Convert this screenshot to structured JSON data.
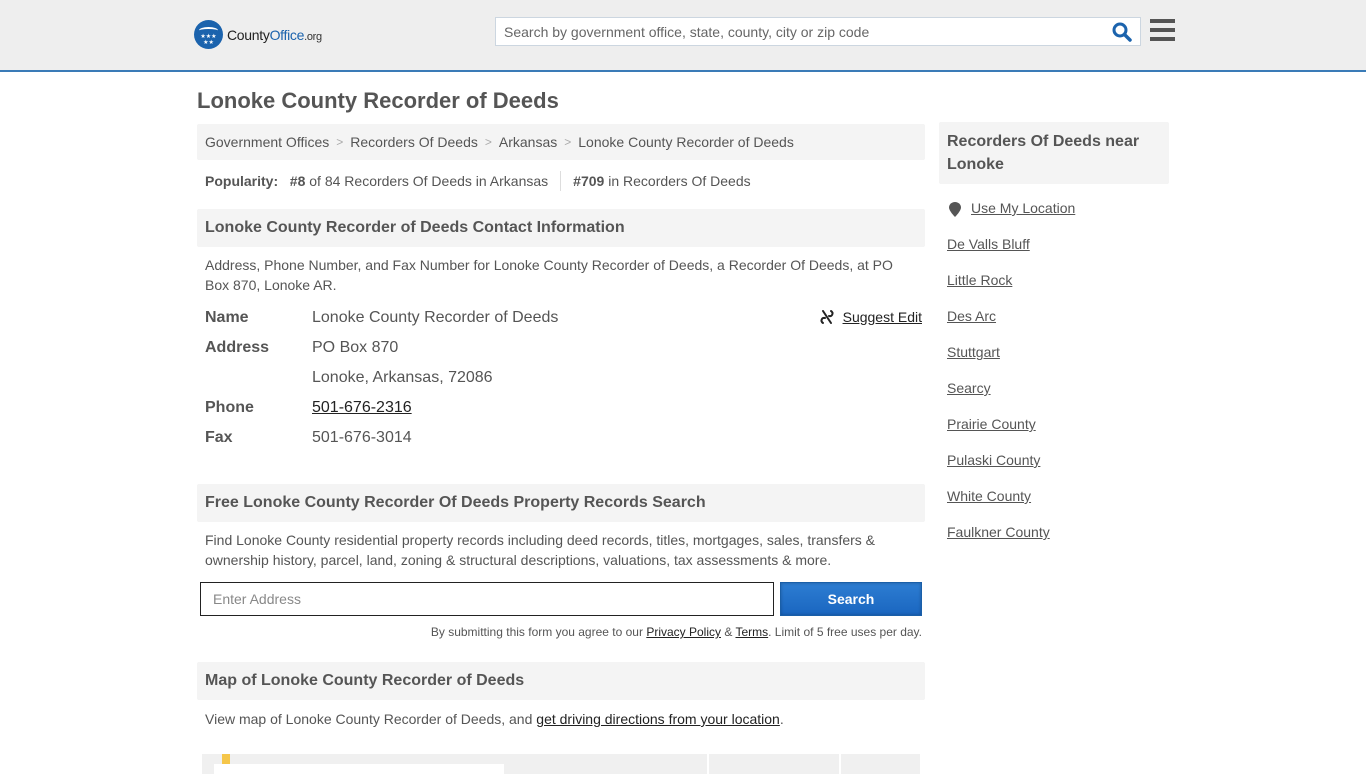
{
  "header": {
    "logo": {
      "name": "County",
      "name_accent": "Office",
      "tld": ".org"
    },
    "search_placeholder": "Search by government office, state, county, city or zip code",
    "icons": {
      "search": "search-icon",
      "menu": "hamburger-menu-icon"
    },
    "accent_color": "#1b63ad"
  },
  "page_title": "Lonoke County Recorder of Deeds",
  "breadcrumb": [
    {
      "label": "Government Offices"
    },
    {
      "label": "Recorders Of Deeds"
    },
    {
      "label": "Arkansas"
    },
    {
      "label": "Lonoke County Recorder of Deeds"
    }
  ],
  "popularity": {
    "label": "Popularity:",
    "state_rank": "#8",
    "state_text": "of 84 Recorders Of Deeds in Arkansas",
    "national_rank": "#709",
    "national_text": "in Recorders Of Deeds"
  },
  "contact": {
    "heading": "Lonoke County Recorder of Deeds Contact Information",
    "description": "Address, Phone Number, and Fax Number for Lonoke County Recorder of Deeds, a Recorder Of Deeds, at PO Box 870, Lonoke AR.",
    "suggest_edit": "Suggest Edit",
    "rows": {
      "name_label": "Name",
      "name_value": "Lonoke County Recorder of Deeds",
      "address_label": "Address",
      "address_line1": "PO Box 870",
      "address_line2": "Lonoke, Arkansas, 72086",
      "phone_label": "Phone",
      "phone_value": "501-676-2316",
      "fax_label": "Fax",
      "fax_value": "501-676-3014"
    }
  },
  "property": {
    "heading": "Free Lonoke County Recorder Of Deeds Property Records Search",
    "description": "Find Lonoke County residential property records including deed records, titles, mortgages, sales, transfers & ownership history, parcel, land, zoning & structural descriptions, valuations, tax assessments & more.",
    "input_placeholder": "Enter Address",
    "button": "Search",
    "disclaimer_pre": "By submitting this form you agree to our ",
    "privacy": "Privacy Policy",
    "amp": " & ",
    "terms": "Terms",
    "disclaimer_post": ". Limit of 5 free uses per day."
  },
  "map": {
    "heading": "Map of Lonoke County Recorder of Deeds",
    "description_pre": "View map of Lonoke County Recorder of Deeds, and ",
    "directions_link": "get driving directions from your location",
    "description_post": "."
  },
  "sidebar": {
    "heading": "Recorders Of Deeds near Lonoke",
    "use_location": "Use My Location",
    "items": [
      "De Valls Bluff",
      "Little Rock",
      "Des Arc",
      "Stuttgart",
      "Searcy",
      "Prairie County",
      "Pulaski County",
      "White County",
      "Faulkner County"
    ]
  }
}
